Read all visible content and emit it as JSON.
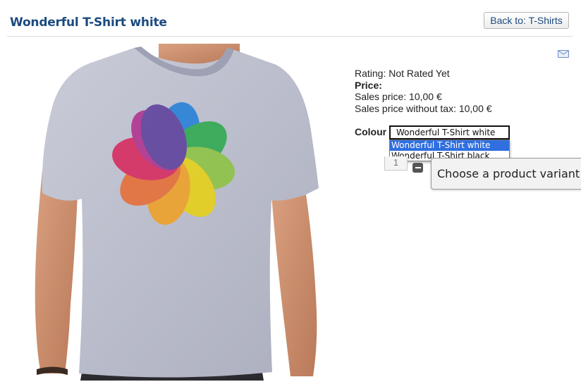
{
  "header": {
    "title": "Wonderful T-Shirt white",
    "back_label": "Back to: T-Shirts"
  },
  "product": {
    "rating_text": "Rating: Not Rated Yet",
    "price_label": "Price:",
    "sales_price_text": "Sales price: 10,00 €",
    "sales_price_no_tax_text": "Sales price without tax: 10,00 €"
  },
  "variant": {
    "label": "Colour",
    "selected_value": "Wonderful T-Shirt white",
    "options": [
      "Wonderful T-Shirt white",
      "Wonderful T-Shirt black"
    ],
    "highlighted_index": 0
  },
  "cart": {
    "quantity": "1",
    "tooltip": "Choose a product variant"
  },
  "icons": {
    "email": "email-icon",
    "minus": "minus-icon"
  },
  "colors": {
    "title": "#1b4a80",
    "shirt": "#b9bccb",
    "dropdown_highlight": "#2f6fe0"
  }
}
